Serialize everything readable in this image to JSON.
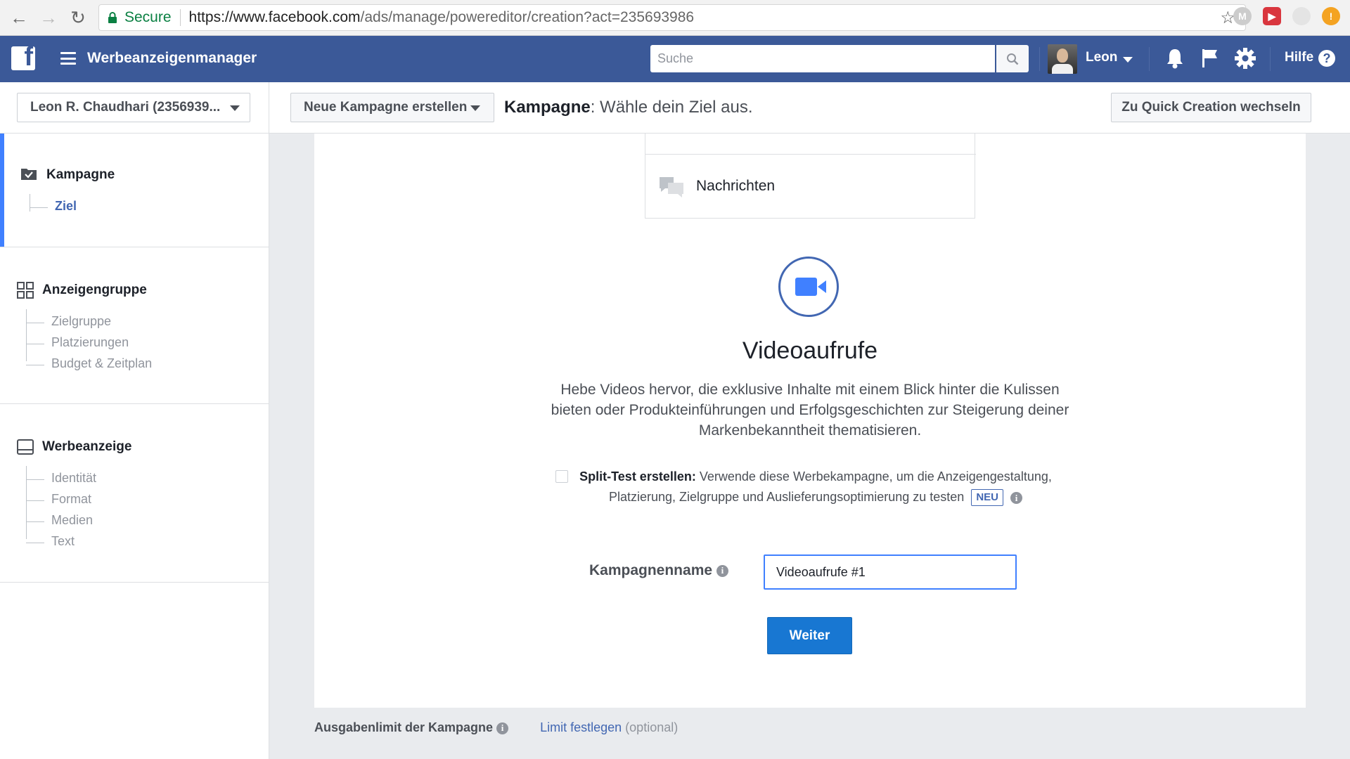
{
  "browser": {
    "secure_label": "Secure",
    "url_host": "https://www.facebook.com",
    "url_path": "/ads/manage/powereditor/creation?act=235693986"
  },
  "header": {
    "app_title": "Werbeanzeigenmanager",
    "search_placeholder": "Suche",
    "user_name": "Leon",
    "help_label": "Hilfe"
  },
  "subbar": {
    "account_label": "Leon R. Chaudhari (2356939...",
    "new_campaign_label": "Neue Kampagne erstellen",
    "breadcrumb_bold": "Kampagne",
    "breadcrumb_rest": ": Wähle dein Ziel aus.",
    "quick_creation_label": "Zu Quick Creation wechseln"
  },
  "sidebar": {
    "campaign": {
      "title": "Kampagne",
      "items": [
        "Ziel"
      ]
    },
    "adset": {
      "title": "Anzeigengruppe",
      "items": [
        "Zielgruppe",
        "Platzierungen",
        "Budget & Zeitplan"
      ]
    },
    "ad": {
      "title": "Werbeanzeige",
      "items": [
        "Identität",
        "Format",
        "Medien",
        "Text"
      ]
    }
  },
  "main": {
    "option_messages": "Nachrichten",
    "objective_title": "Videoaufrufe",
    "objective_description": "Hebe Videos hervor, die exklusive Inhalte mit einem Blick hinter die Kulissen bieten oder Produkteinführungen und Erfolgsgeschichten zur Steigerung deiner Markenbekanntheit thematisieren.",
    "split_test_bold": "Split-Test erstellen:",
    "split_test_text": " Verwende diese Werbekampagne, um die Anzeigengestaltung, Platzierung, Zielgruppe und Auslieferungsoptimierung zu testen",
    "new_badge": "NEU",
    "campaign_name_label": "Kampagnenname",
    "campaign_name_value": "Videoaufrufe #1",
    "continue_label": "Weiter",
    "spend_limit_label": "Ausgabenlimit der Kampagne",
    "set_limit_link": "Limit festlegen",
    "optional_label": "(optional)"
  },
  "colors": {
    "fb_blue": "#3b5998",
    "accent": "#4267b2",
    "button_blue": "#1877d2"
  }
}
